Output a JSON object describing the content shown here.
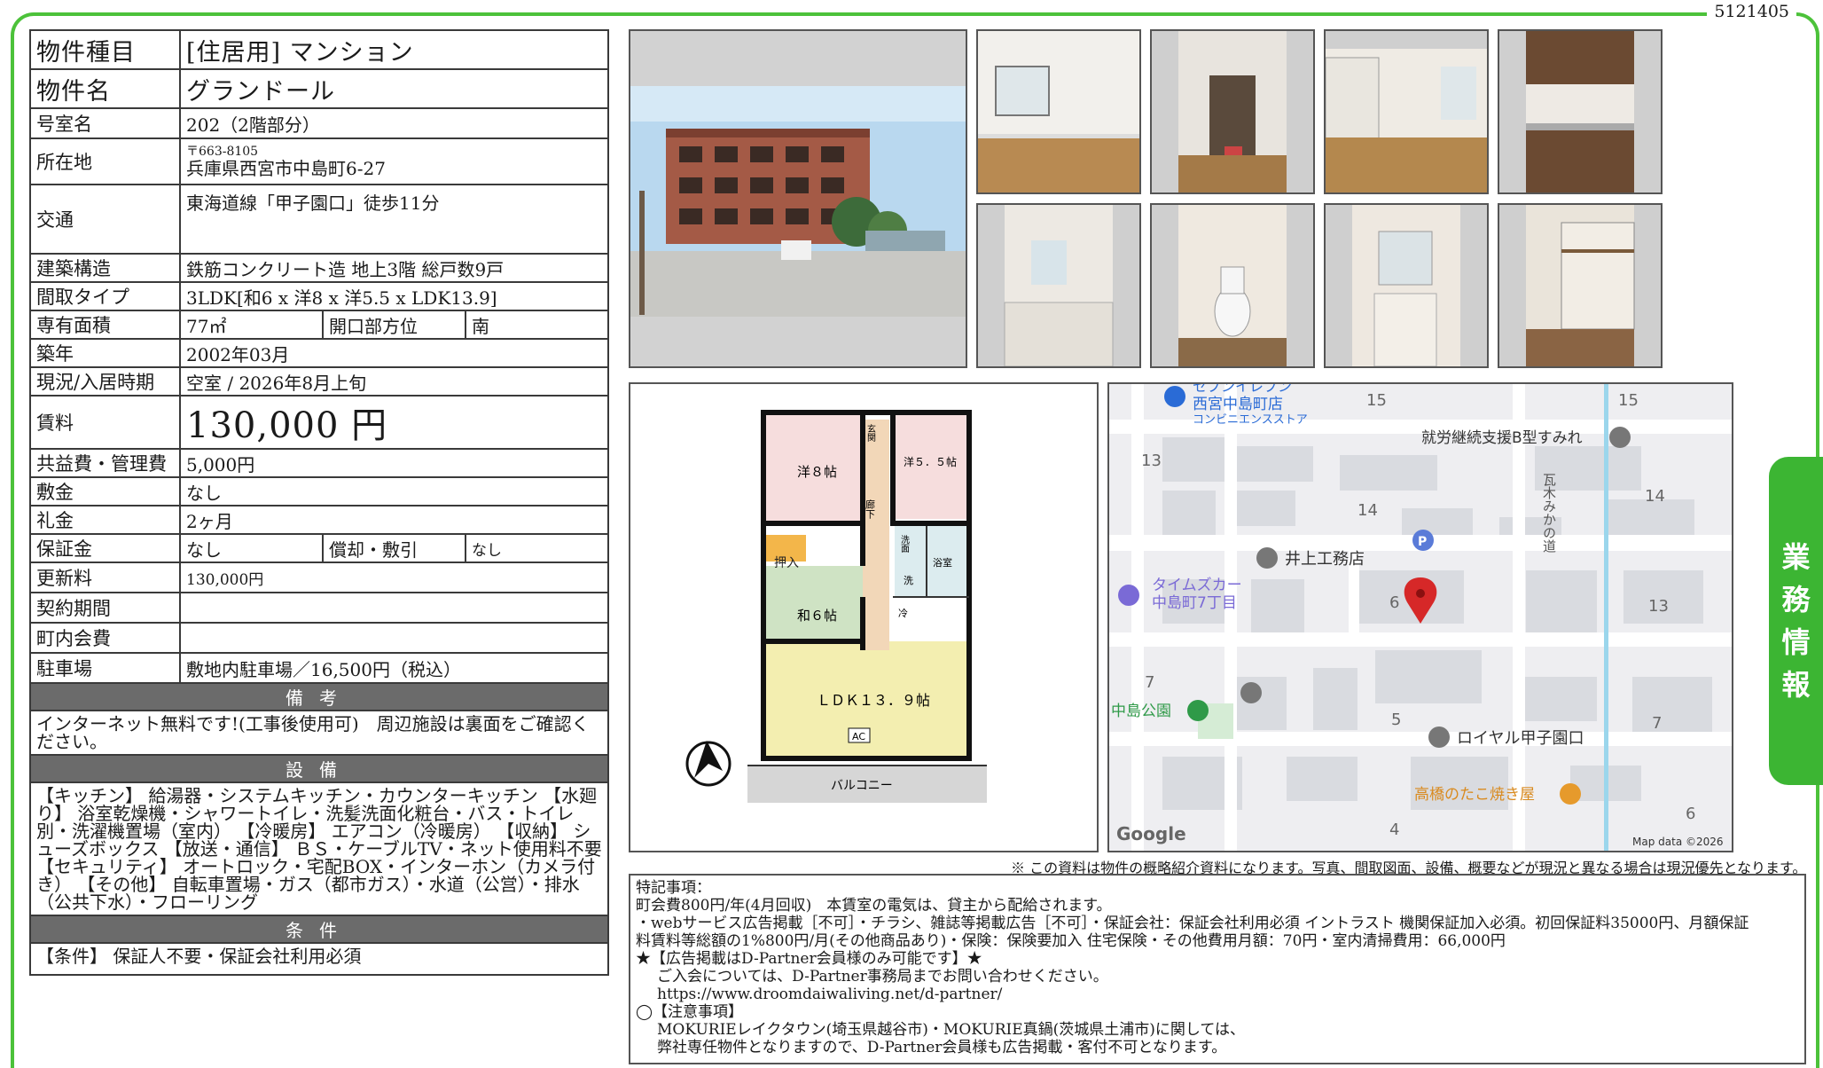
{
  "doc_id": "5121405",
  "info": {
    "type_label": "物件種目",
    "type_value": "[住居用] マンション",
    "name_label": "物件名",
    "name_value": "グランドール",
    "room_label": "号室名",
    "room_value": "202（2階部分）",
    "addr_label": "所在地",
    "addr_zip": "〒663-8105",
    "addr_value": "兵庫県西宮市中島町6-27",
    "access_label": "交通",
    "access_value": "東海道線「甲子園口」徒歩11分",
    "structure_label": "建築構造",
    "structure_value": "鉄筋コンクリート造 地上3階 総戸数9戸",
    "layout_label": "間取タイプ",
    "layout_value": "3LDK[和6 x 洋8 x 洋5.5 x LDK13.9]",
    "area_label": "専有面積",
    "area_value": "77㎡",
    "direction_label": "開口部方位",
    "direction_value": "南",
    "built_label": "築年",
    "built_value": "2002年03月",
    "status_label": "現況/入居時期",
    "status_value": "空室 / 2026年8月上旬",
    "rent_label": "賃料",
    "rent_value": "130,000 円",
    "fee_label": "共益費・管理費",
    "fee_value": "5,000円",
    "deposit_label": "敷金",
    "deposit_value": "なし",
    "key_label": "礼金",
    "key_value": "2ヶ月",
    "guarantee_label": "保証金",
    "guarantee_value": "なし",
    "amort_label": "償却・敷引",
    "amort_value": "なし",
    "renew_label": "更新料",
    "renew_value": "130,000円",
    "contract_label": "契約期間",
    "contract_value": "",
    "town_label": "町内会費",
    "town_value": "",
    "parking_label": "駐車場",
    "parking_value": "敷地内駐車場／16,500円（税込）"
  },
  "remarks_head": "備考",
  "remarks_text": "インターネット無料です!(工事後使用可)　周辺施設は裏面をご確認ください。",
  "equip_head": "設備",
  "equip_text": "【キッチン】 給湯器・システムキッチン・カウンターキッチン 【水廻り】 浴室乾燥機・シャワートイレ・洗髪洗面化粧台・バス・トイレ別・洗濯機置場（室内） 【冷暖房】 エアコン（冷暖房） 【収納】 シューズボックス 【放送・通信】 ＢＳ・ケーブルTV・ネット使用料不要 【セキュリティ】 オートロック・宅配BOX・インターホン（カメラ付き） 【その他】 自転車置場・ガス（都市ガス）・水道（公営）・排水（公共下水）・フローリング",
  "cond_head": "条件",
  "cond_text": "【条件】 保証人不要・保証会社利用必須",
  "floorplan": {
    "room_western8": "洋８帖",
    "room_western55": "洋５．５帖",
    "room_japanese6": "和６帖",
    "room_ldk": "ＬＤＫ１３．９帖",
    "room_closet": "押入",
    "room_hall": "廊下",
    "room_entrance": "玄関",
    "room_wash": "洗面",
    "room_bath": "浴室",
    "room_fridge": "冷",
    "room_washer": "洗",
    "ac": "AC",
    "balcony": "バルコニー"
  },
  "map": {
    "seven_name": "セブンイレブン",
    "seven_branch": "西宮中島町店",
    "seven_sub": "コンビニエンスストア",
    "support": "就労継続支援B型すみれ",
    "inoue": "井上工務店",
    "times": "タイムズカー",
    "times_sub": "中島町7丁目",
    "park": "中島公園",
    "royal": "ロイヤル甲子園口",
    "tako": "高橋のたこ焼き屋",
    "road": "瓦木みかの道",
    "parking_mark": "P",
    "google": "Google",
    "copyright": "Map data ©2026",
    "blocks": [
      "15",
      "15",
      "13",
      "14",
      "14",
      "6",
      "13",
      "7",
      "5",
      "7",
      "4",
      "6"
    ]
  },
  "disclaimer": "※ この資料は物件の概略紹介資料になります。写真、間取図面、設備、概要などが現況と異なる場合は現況優先となります。",
  "notes": {
    "l1": "特記事項：",
    "l2": "町会費800円/年(4月回収)　本賃室の電気は、貸主から配給されます。",
    "l3": "・webサービス広告掲載［不可］・チラシ、雑誌等掲載広告［不可］・保証会社：保証会社利用必須 イントラスト 機関保証加入必須。初回保証料35000円、月額保証",
    "l4": "料賃料等総額の1%800円/月(その他商品あり)・保険：保険要加入 住宅保険・その他費用月額：70円・室内清掃費用：66,000円",
    "l5": "★【広告掲載はD-Partner会員様のみ可能です】★",
    "l6": "ご入会については、D-Partner事務局までお問い合わせください。",
    "l7": "https://www.droomdaiwaliving.net/d-partner/",
    "l8": "◯【注意事項】",
    "l9": "MOKURIEレイクタウン(埼玉県越谷市)・MOKURIE真鍋(茨城県土浦市)に関しては、",
    "l10": "弊社専任物件となりますので、D-Partner会員様も広告掲載・客付不可となります。"
  },
  "side_tab": [
    "業",
    "務",
    "情",
    "報"
  ]
}
